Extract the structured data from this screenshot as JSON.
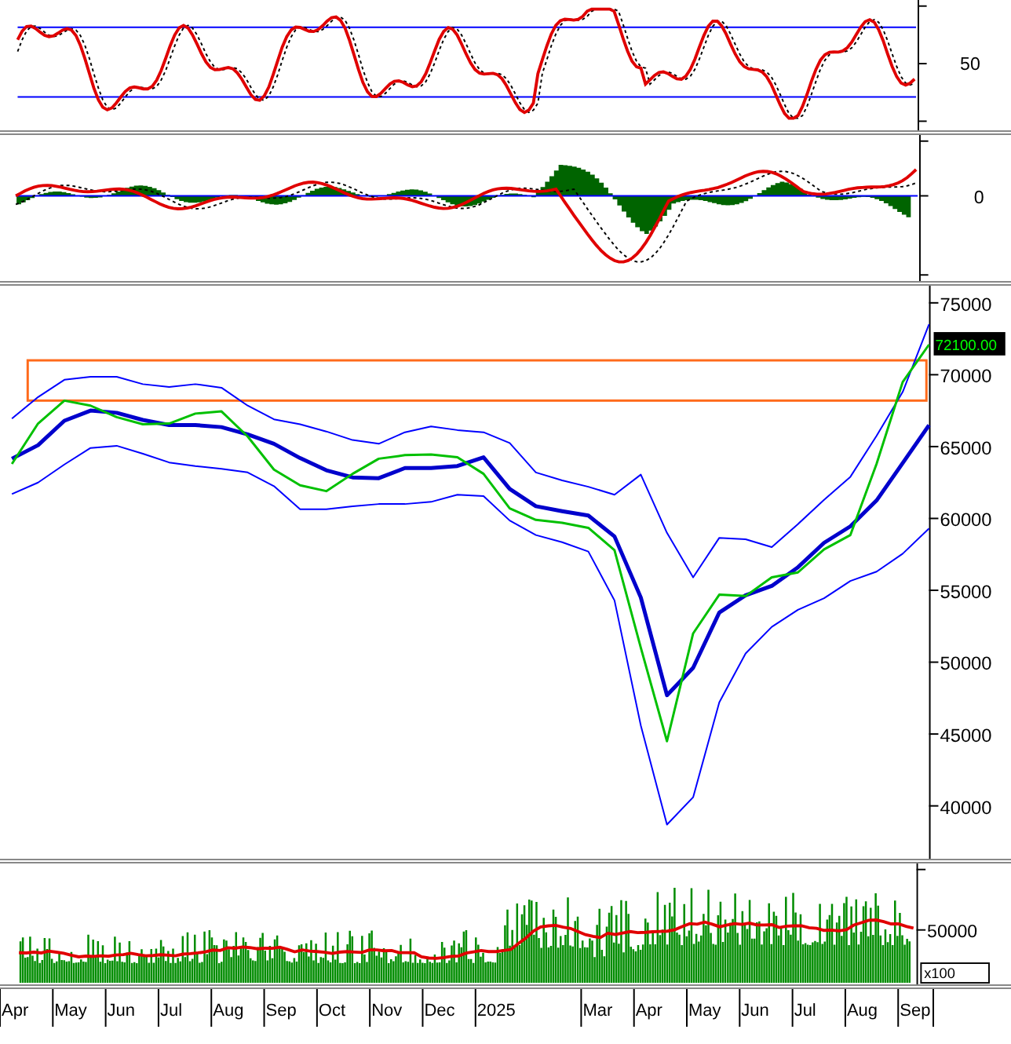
{
  "rsi_panel": {
    "tick_label": "50"
  },
  "macd_panel": {
    "tick_label": "0"
  },
  "price_panel": {
    "last_price": "72100.00",
    "chart_data": {
      "type": "line",
      "ylim": [
        36322,
        76192
      ],
      "yticks": [
        40000,
        45000,
        50000,
        55000,
        60000,
        65000,
        70000,
        75000
      ],
      "categories": [
        "Apr",
        null,
        "May",
        null,
        "Jun",
        null,
        "Jul",
        null,
        "Aug",
        null,
        "Sep",
        null,
        "Oct",
        null,
        "Nov",
        null,
        "Dec",
        null,
        "2025",
        null,
        null,
        null,
        "Mar",
        null,
        "Apr",
        null,
        "May",
        null,
        "Jun",
        null,
        "Jul",
        null,
        "Aug",
        null,
        "Sep",
        null
      ],
      "series": [
        {
          "color": "#0000ff",
          "values": [
            66950,
            68450,
            69650,
            69850,
            69850,
            69350,
            69150,
            69350,
            69100,
            67850,
            66900,
            66550,
            66050,
            65450,
            65200,
            66000,
            66400,
            66150,
            66000,
            65250,
            63200,
            62650,
            62200,
            61650,
            63050,
            59000,
            55900,
            58650,
            58550,
            58000,
            59600,
            61300,
            62900,
            65750,
            68800,
            73500
          ]
        },
        {
          "color": "#0000cc",
          "values": [
            64150,
            65100,
            66800,
            67500,
            67350,
            66850,
            66500,
            66500,
            66350,
            65850,
            65200,
            64200,
            63350,
            62850,
            62800,
            63500,
            63500,
            63650,
            64250,
            62050,
            60850,
            60500,
            60200,
            58750,
            54500,
            47700,
            49600,
            53450,
            54650,
            55300,
            56600,
            58300,
            59450,
            61250,
            63850,
            66500
          ]
        },
        {
          "color": "#0000ff",
          "values": [
            61700,
            62500,
            63750,
            64900,
            65050,
            64500,
            63900,
            63650,
            63450,
            63200,
            62250,
            60650,
            60650,
            60850,
            61000,
            61000,
            61150,
            61650,
            61550,
            59850,
            58850,
            58350,
            57700,
            54300,
            45600,
            38700,
            40600,
            47200,
            50600,
            52450,
            53650,
            54450,
            55650,
            56300,
            57550,
            59300
          ]
        },
        {
          "color": "#00c000",
          "values": [
            63800,
            66600,
            68200,
            67850,
            67050,
            66550,
            66600,
            67300,
            67450,
            65700,
            63400,
            62300,
            61900,
            63100,
            64150,
            64400,
            64450,
            64250,
            63100,
            60700,
            59900,
            59700,
            59350,
            57800,
            51000,
            44500,
            52000,
            54700,
            54600,
            55900,
            56250,
            57850,
            58850,
            63800,
            69500,
            72100
          ]
        }
      ]
    }
  },
  "volume_panel": {
    "tick_label": "50000",
    "unit": "x100"
  }
}
